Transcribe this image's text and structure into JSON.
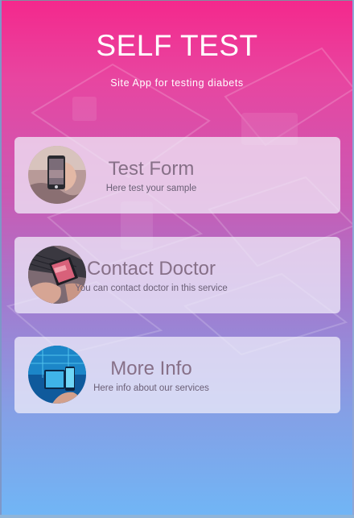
{
  "header": {
    "title": "SELF TEST",
    "subtitle": "Site App for testing diabets"
  },
  "cards": [
    {
      "title": "Test Form",
      "description": "Here test your sample",
      "image_icon": "phone-camera-photo"
    },
    {
      "title": "Contact Doctor",
      "description": "You can contact doctor in this service",
      "image_icon": "phone-laptop-photo"
    },
    {
      "title": "More Info",
      "description": "Here info about our services",
      "image_icon": "tablet-blue-photo"
    }
  ],
  "colors": {
    "gradient_top": "#f4288c",
    "gradient_bottom": "#70b6f6",
    "card_title": "#877088",
    "card_text": "#6b5f76"
  }
}
